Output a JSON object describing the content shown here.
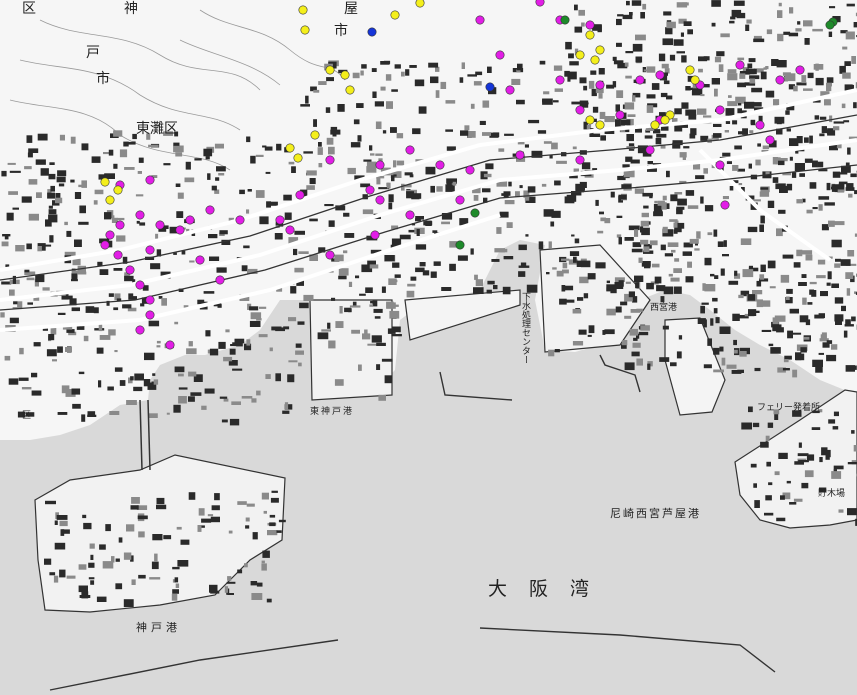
{
  "labels": {
    "ward_top_left": "区",
    "kobe_city_1": "神",
    "kobe_city_2": "戸",
    "kobe_city_3": "市",
    "higashinada_ward": "東灘区",
    "ashiya_city": "市",
    "ashiya_area": "屋",
    "osaka_bay": "大阪湾",
    "amagasaki_port": "尼崎西宮芦屋港",
    "kobe_port": "神戸港",
    "higashi_kobe_port": "東神戸港",
    "nishinomiya_port": "西宮港",
    "sewage_center": "下水処理センター",
    "ferry_terminal": "フェリー発着所",
    "storage_yard": "貯木場",
    "ward_left": "区"
  },
  "markers": {
    "magenta": {
      "color": "#e21ee6",
      "meaning": "magenta-point"
    },
    "yellow": {
      "color": "#f4ef1c",
      "meaning": "yellow-point"
    },
    "blue": {
      "color": "#1535d8",
      "meaning": "blue-point"
    },
    "green": {
      "color": "#1e8a2a",
      "meaning": "green-point"
    }
  },
  "colors": {
    "sea": "#d9d9d9",
    "land": "#f6f6f6",
    "block": "#2a2a2a",
    "road": "#ffffff",
    "line": "#333333"
  }
}
